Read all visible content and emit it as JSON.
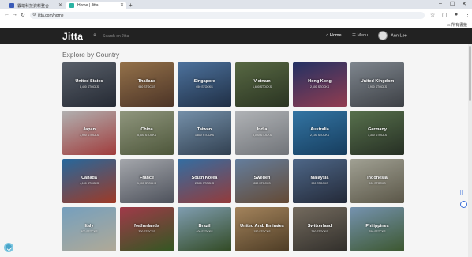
{
  "browser": {
    "tabs": [
      {
        "title": "雲端科技資料整合",
        "active": false
      },
      {
        "title": "Home | Jitta",
        "active": true
      }
    ],
    "url": "jitta.com/home",
    "bookmarks_label": "所有書籤"
  },
  "site": {
    "logo": "Jitta",
    "search_placeholder": "Search on Jitta",
    "nav": {
      "home": "Home",
      "menu": "Menu",
      "user": "Ann Lee"
    }
  },
  "main": {
    "section_title": "Explore by Country",
    "countries": [
      {
        "name": "United States",
        "count": "8,400 STOCKS",
        "colors": [
          "#6c7480",
          "#2e3440"
        ]
      },
      {
        "name": "Thailand",
        "count": "950 STOCKS",
        "colors": [
          "#b48a5a",
          "#5d4030"
        ]
      },
      {
        "name": "Singapore",
        "count": "650 STOCKS",
        "colors": [
          "#5e8bbf",
          "#273a55"
        ]
      },
      {
        "name": "Vietnam",
        "count": "1,600 STOCKS",
        "colors": [
          "#6b7f52",
          "#34402a"
        ]
      },
      {
        "name": "Hong Kong",
        "count": "2,600 STOCKS",
        "colors": [
          "#2c3d7a",
          "#b34a62"
        ]
      },
      {
        "name": "United Kingdom",
        "count": "1,900 STOCKS",
        "colors": [
          "#9aa3ad",
          "#4b4f55"
        ]
      },
      {
        "name": "Japan",
        "count": "3,900 STOCKS",
        "colors": [
          "#d8d8d8",
          "#c44a4a"
        ]
      },
      {
        "name": "China",
        "count": "5,300 STOCKS",
        "colors": [
          "#b0b89a",
          "#5f6a48"
        ]
      },
      {
        "name": "Taiwan",
        "count": "1,800 STOCKS",
        "colors": [
          "#8fb0cf",
          "#3d4f63"
        ]
      },
      {
        "name": "India",
        "count": "5,000 STOCKS",
        "colors": [
          "#d7dade",
          "#8a8e94"
        ]
      },
      {
        "name": "Australia",
        "count": "2,100 STOCKS",
        "colors": [
          "#3f8fc8",
          "#1c4b73"
        ]
      },
      {
        "name": "Germany",
        "count": "1,300 STOCKS",
        "colors": [
          "#6b8a5e",
          "#2f3a2c"
        ]
      },
      {
        "name": "Canada",
        "count": "4,100 STOCKS",
        "colors": [
          "#2f7fbf",
          "#c2472f"
        ]
      },
      {
        "name": "France",
        "count": "1,000 STOCKS",
        "colors": [
          "#c9ccd2",
          "#5f6470"
        ]
      },
      {
        "name": "South Korea",
        "count": "2,500 STOCKS",
        "colors": [
          "#3f86c6",
          "#b54848"
        ]
      },
      {
        "name": "Sweden",
        "count": "850 STOCKS",
        "colors": [
          "#7a9ac0",
          "#7a5a40"
        ]
      },
      {
        "name": "Malaysia",
        "count": "900 STOCKS",
        "colors": [
          "#5f7ea6",
          "#2c3345"
        ]
      },
      {
        "name": "Indonesia",
        "count": "900 STOCKS",
        "colors": [
          "#c4c4b4",
          "#6f6a58"
        ]
      },
      {
        "name": "Italy",
        "count": "400 STOCKS",
        "colors": [
          "#8fc3e8",
          "#d8cfb8"
        ]
      },
      {
        "name": "Netherlands",
        "count": "300 STOCKS",
        "colors": [
          "#c4475a",
          "#3e6b2a"
        ]
      },
      {
        "name": "Brazil",
        "count": "400 STOCKS",
        "colors": [
          "#9cc0d8",
          "#3d5b2c"
        ]
      },
      {
        "name": "United Arab Emirates",
        "count": "150 STOCKS",
        "colors": [
          "#c7a070",
          "#5f4a2e"
        ]
      },
      {
        "name": "Switzerland",
        "count": "250 STOCKS",
        "colors": [
          "#8d8273",
          "#3d3a35"
        ]
      },
      {
        "name": "Philippines",
        "count": "250 STOCKS",
        "colors": [
          "#8fb3d6",
          "#4a6b3a"
        ]
      }
    ]
  }
}
